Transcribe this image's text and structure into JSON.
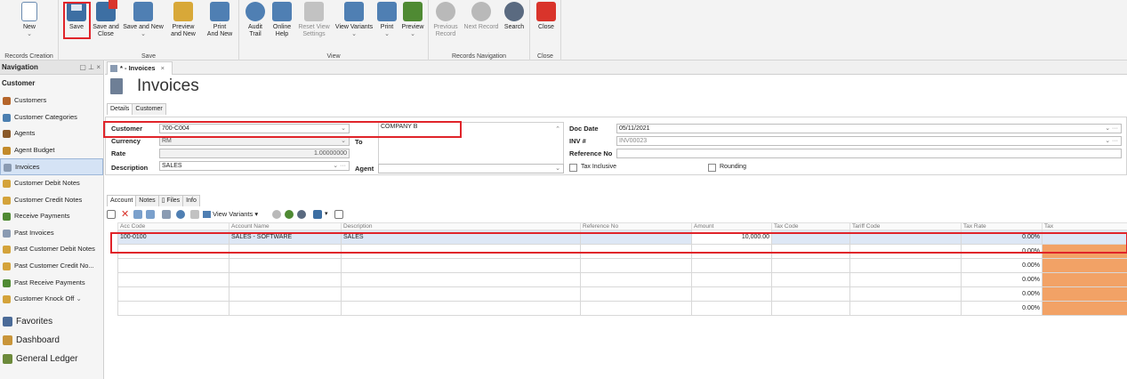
{
  "ribbon": {
    "groups": {
      "records_creation": "Records Creation",
      "save": "Save",
      "view": "View",
      "records_navigation": "Records Navigation",
      "close": "Close"
    },
    "buttons": {
      "new": "New",
      "save": "Save",
      "save_and_close_1": "Save and",
      "save_and_close_2": "Close",
      "save_and_new": "Save and New",
      "preview_1": "Preview",
      "preview_2": "and New",
      "print_1": "Print",
      "print_2": "And New",
      "audit_1": "Audit",
      "audit_2": "Trail",
      "online_1": "Online",
      "online_2": "Help",
      "reset_1": "Reset View",
      "reset_2": "Settings",
      "view_variants": "View Variants",
      "print": "Print",
      "preview": "Preview",
      "previous_1": "Previous",
      "previous_2": "Record",
      "next_record": "Next Record",
      "search": "Search",
      "close": "Close"
    }
  },
  "navigation": {
    "header": "Navigation",
    "section": "Customer",
    "items": [
      "Customers",
      "Customer Categories",
      "Agents",
      "Agent Budget",
      "Invoices",
      "Customer Debit Notes",
      "Customer Credit Notes",
      "Receive Payments",
      "Past Invoices",
      "Past Customer Debit Notes",
      "Past Customer Credit No...",
      "Past Receive Payments",
      "Customer Knock Off"
    ],
    "bottom": [
      "Favorites",
      "Dashboard",
      "General Ledger"
    ]
  },
  "doc_tab": {
    "label": "* - Invoices"
  },
  "page_title": "Invoices",
  "top_tabs": [
    "Details",
    "Customer"
  ],
  "form": {
    "customer_label": "Customer",
    "customer_value": "700-C004",
    "company_name": "COMPANY B",
    "currency_label": "Currency",
    "currency_value": "RM",
    "to_label": "To",
    "rate_label": "Rate",
    "rate_value": "1.00000000",
    "description_label": "Description",
    "description_value": "SALES",
    "agent_label": "Agent",
    "agent_value": "",
    "doc_date_label": "Doc Date",
    "doc_date_value": "05/11/2021",
    "inv_label": "INV #",
    "inv_value": "INV00023",
    "reference_label": "Reference No",
    "reference_value": "",
    "tax_inclusive": "Tax Inclusive",
    "rounding": "Rounding"
  },
  "lower_tabs": [
    "Account",
    "Notes",
    "Files",
    "Info"
  ],
  "grid_toolbar": {
    "view_variants": "View Variants"
  },
  "grid": {
    "columns": [
      "Acc Code",
      "Account Name",
      "Description",
      "Reference No",
      "Amount",
      "Tax Code",
      "Tariff Code",
      "Tax Rate",
      "Tax"
    ],
    "rows": [
      {
        "acc_code": "100-0100",
        "account_name": "SALES - SOFTWARE",
        "description": "SALES",
        "reference": "",
        "amount": "10,000.00",
        "tax_code": "",
        "tariff": "",
        "tax_rate": "0.00%",
        "tax": ""
      },
      {
        "acc_code": "",
        "account_name": "",
        "description": "",
        "reference": "",
        "amount": "",
        "tax_code": "",
        "tariff": "",
        "tax_rate": "0.00%",
        "tax": ""
      },
      {
        "acc_code": "",
        "account_name": "",
        "description": "",
        "reference": "",
        "amount": "",
        "tax_code": "",
        "tariff": "",
        "tax_rate": "0.00%",
        "tax": ""
      },
      {
        "acc_code": "",
        "account_name": "",
        "description": "",
        "reference": "",
        "amount": "",
        "tax_code": "",
        "tariff": "",
        "tax_rate": "0.00%",
        "tax": ""
      },
      {
        "acc_code": "",
        "account_name": "",
        "description": "",
        "reference": "",
        "amount": "",
        "tax_code": "",
        "tariff": "",
        "tax_rate": "0.00%",
        "tax": ""
      },
      {
        "acc_code": "",
        "account_name": "",
        "description": "",
        "reference": "",
        "amount": "",
        "tax_code": "",
        "tariff": "",
        "tax_rate": "0.00%",
        "tax": ""
      }
    ]
  },
  "colors": {
    "highlight": "#e0242a",
    "tax_fill": "#f2a266",
    "selected_row": "#dde7f5"
  }
}
